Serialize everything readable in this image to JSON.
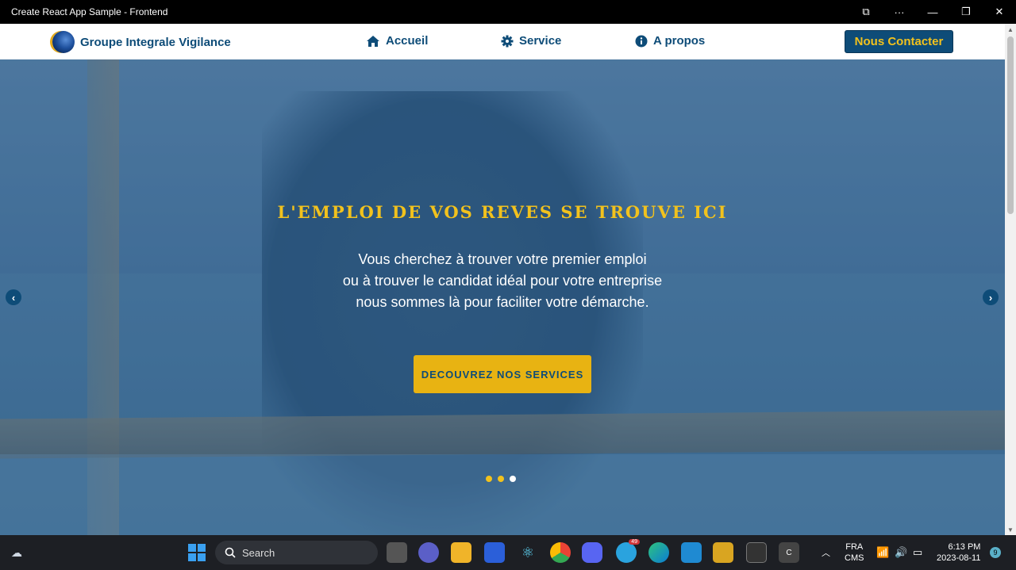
{
  "window": {
    "title": "Create React App Sample - Frontend",
    "controls": {
      "cast": "⧉",
      "more": "···",
      "minimize": "—",
      "restore": "❐",
      "close": "✕"
    }
  },
  "navbar": {
    "brand": "Groupe Integrale Vigilance",
    "items": [
      {
        "label": "Accueil",
        "icon": "home-icon"
      },
      {
        "label": "Service",
        "icon": "gear-icon"
      },
      {
        "label": "A propos",
        "icon": "info-icon"
      }
    ],
    "contact_label": "Nous Contacter"
  },
  "hero": {
    "title": "L'EMPLOI DE VOS REVES SE TROUVE ICI",
    "lines": [
      "Vous cherchez à trouver votre premier emploi",
      "ou à trouver le candidat idéal pour votre entreprise",
      "nous sommes là pour faciliter votre démarche."
    ],
    "cta_label": "DECOUVREZ NOS SERVICES",
    "prev_label": "‹",
    "next_label": "›",
    "slides": 3,
    "active_slide": 3
  },
  "taskbar": {
    "search_label": "Search",
    "language": "FRA",
    "keyboard": "CMS",
    "time": "6:13 PM",
    "date": "2023-08-11",
    "notifications": "9",
    "telegram_badge": "49"
  },
  "colors": {
    "brand_blue": "#0e4c78",
    "accent_yellow": "#f2c21d",
    "cta_yellow": "#e8b312"
  }
}
